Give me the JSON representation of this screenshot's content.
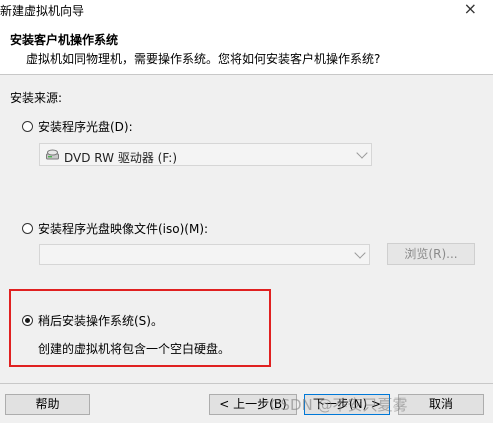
{
  "window": {
    "title": "新建虚拟机向导",
    "close_glyph": "×"
  },
  "header": {
    "title": "安装客户机操作系统",
    "subtitle": "虚拟机如同物理机，需要操作系统。您将如何安装客户机操作系统?"
  },
  "install_source": {
    "label": "安装来源:",
    "options": [
      {
        "label": "安装程序光盘(D):",
        "selected": false
      },
      {
        "label": "安装程序光盘映像文件(iso)(M):",
        "selected": false
      },
      {
        "label": "稍后安装操作系统(S)。",
        "selected": true
      }
    ],
    "disc_drive": {
      "value": "DVD RW 驱动器 (F:)",
      "icon": "dvd-drive-icon"
    },
    "iso_path": {
      "value": ""
    },
    "browse_button": "浏览(R)...",
    "later_description": "创建的虚拟机将包含一个空白硬盘。"
  },
  "footer": {
    "help": "帮助",
    "back": "< 上一步(B)",
    "next": "下一步(N) >",
    "cancel": "取消"
  },
  "watermark": "CSDN @不安只夏雾",
  "colors": {
    "highlight": "#e02020",
    "accent": "#0078d7"
  }
}
